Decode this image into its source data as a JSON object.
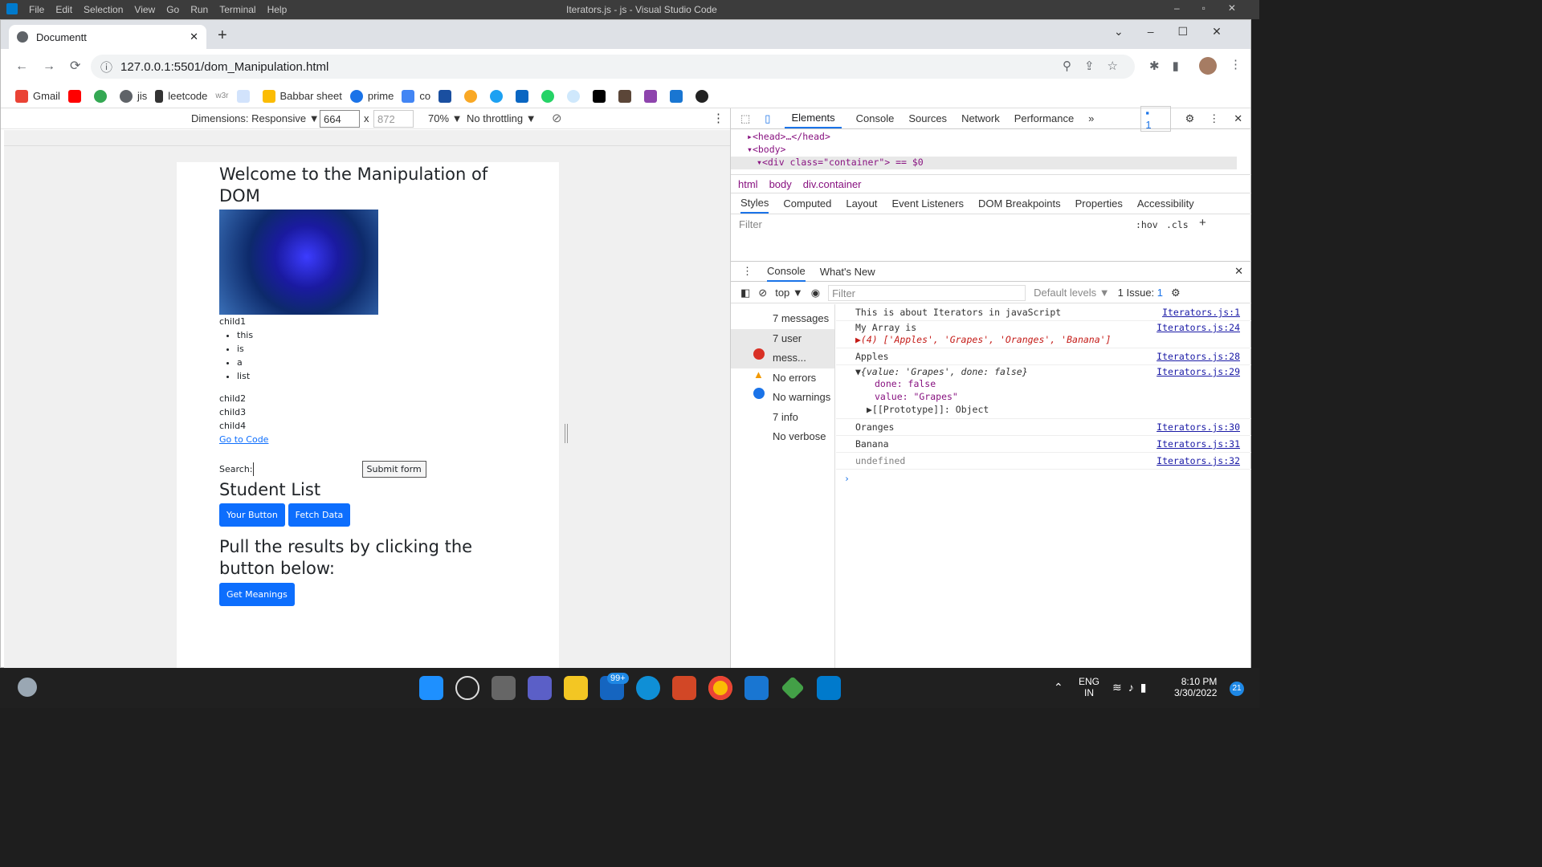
{
  "vscode": {
    "title": "Iterators.js - js - Visual Studio Code",
    "menu": [
      "File",
      "Edit",
      "Selection",
      "View",
      "Go",
      "Run",
      "Terminal",
      "Help"
    ]
  },
  "browser": {
    "tab_title": "Documentt",
    "url": "127.0.0.1:5501/dom_Manipulation.html",
    "bookmarks": [
      "Gmail",
      "jis",
      "leetcode",
      "w3r",
      "Babbar sheet",
      "prime",
      "co"
    ],
    "toolbar": {
      "dimensions_label": "Dimensions: Responsive",
      "width": "664",
      "height_placeholder": "872",
      "zoom": "70%",
      "throttling": "No throttling"
    }
  },
  "page": {
    "heading": "Welcome to the Manipulation of DOM",
    "child1": "child1",
    "list": [
      "this",
      "is",
      "a",
      "list"
    ],
    "child2": "child2",
    "child3": "child3",
    "child4": "child4",
    "link": "Go to Code",
    "search_label": "Search:",
    "submit": "Submit form",
    "student_heading": "Student List",
    "btn_your": "Your Button",
    "btn_fetch": "Fetch Data",
    "pull_heading": "Pull the results by clicking the button below:",
    "btn_meanings": "Get Meanings"
  },
  "devtools": {
    "tabs": [
      "Elements",
      "Console",
      "Sources",
      "Network",
      "Performance"
    ],
    "issues_count": "1",
    "dom": [
      "<head>…</head>",
      "<body>",
      "<div class=\"container\"> == $0"
    ],
    "breadcrumb": [
      "html",
      "body",
      "div.container"
    ],
    "style_tabs": [
      "Styles",
      "Computed",
      "Layout",
      "Event Listeners",
      "DOM Breakpoints",
      "Properties",
      "Accessibility"
    ],
    "filter_placeholder": "Filter",
    "hov": ":hov",
    "cls": ".cls",
    "drawer_tabs": [
      "Console",
      "What's New"
    ],
    "context": "top",
    "levels": "Default levels",
    "issue_label": "1 Issue:",
    "sidebar": [
      "7 messages",
      "7 user mess...",
      "No errors",
      "No warnings",
      "7 info",
      "No verbose"
    ],
    "logs": [
      {
        "msg": "This is about Iterators in javaScript",
        "src": "Iterators.js:1"
      },
      {
        "msg": "My Array is",
        "src": "Iterators.js:24"
      },
      {
        "msg": "▶(4) ['Apples', 'Grapes', 'Oranges', 'Banana']",
        "src": ""
      },
      {
        "msg": "Apples",
        "src": "Iterators.js:28"
      },
      {
        "msg": "▼{value: 'Grapes', done: false}",
        "src": "Iterators.js:29"
      },
      {
        "msg": "done: false",
        "src": ""
      },
      {
        "msg": "value: \"Grapes\"",
        "src": ""
      },
      {
        "msg": "▶[[Prototype]]: Object",
        "src": ""
      },
      {
        "msg": "Oranges",
        "src": "Iterators.js:30"
      },
      {
        "msg": "Banana",
        "src": "Iterators.js:31"
      },
      {
        "msg": "undefined",
        "src": "Iterators.js:32"
      }
    ]
  },
  "taskbar": {
    "lang": "ENG",
    "region": "IN",
    "time": "8:10 PM",
    "date": "3/30/2022",
    "mail_badge": "99+",
    "notif": "21"
  }
}
